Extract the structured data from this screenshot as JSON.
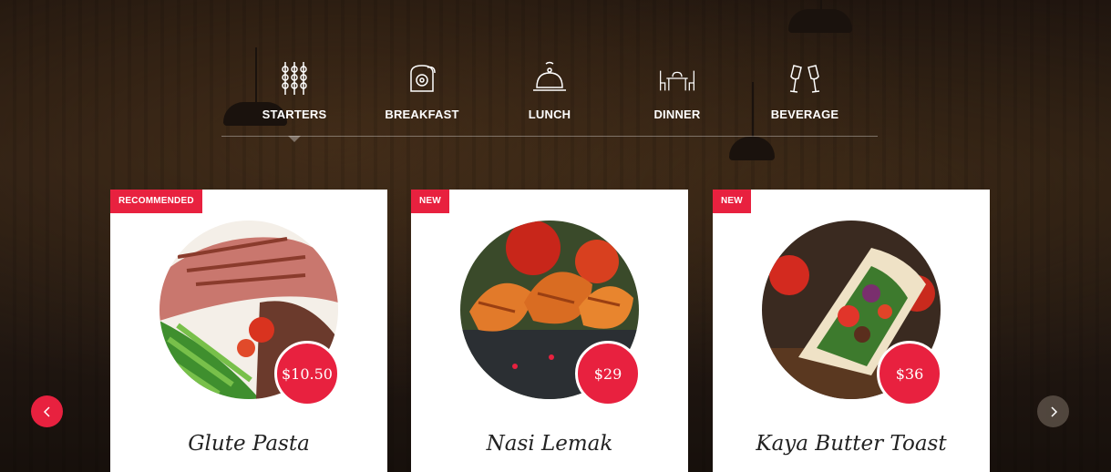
{
  "tabs": [
    {
      "label": "STARTERS",
      "icon": "skewers-icon",
      "active": true
    },
    {
      "label": "BREAKFAST",
      "icon": "toast-icon",
      "active": false
    },
    {
      "label": "LUNCH",
      "icon": "cloche-icon",
      "active": false
    },
    {
      "label": "DINNER",
      "icon": "dining-table-icon",
      "active": false
    },
    {
      "label": "BEVERAGE",
      "icon": "glasses-icon",
      "active": false
    }
  ],
  "cards": [
    {
      "badge": "RECOMMENDED",
      "price": "$10.50",
      "name": "Glute Pasta"
    },
    {
      "badge": "NEW",
      "price": "$29",
      "name": "Nasi Lemak"
    },
    {
      "badge": "NEW",
      "price": "$36",
      "name": "Kaya Butter Toast"
    }
  ],
  "nav": {
    "prev_icon": "chevron-left-icon",
    "next_icon": "chevron-right-icon"
  },
  "colors": {
    "accent": "#e8213f",
    "card_bg": "#ffffff",
    "text_dark": "#222222"
  }
}
